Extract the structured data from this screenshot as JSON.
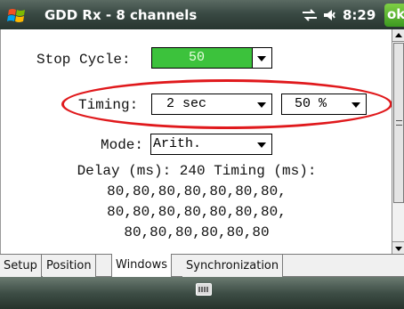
{
  "titlebar": {
    "title": "GDD Rx - 8 channels",
    "time": "8:29",
    "ok_label": "ok"
  },
  "form": {
    "stop_cycle_label": "Stop Cycle:",
    "stop_cycle_value": "50",
    "timing_label": "Timing:",
    "timing_value": "2 sec",
    "timing_percent": "50 %",
    "mode_label": "Mode:",
    "mode_value": "Arith."
  },
  "info": {
    "line1": "Delay (ms): 240 Timing (ms):",
    "line2": "80,80,80,80,80,80,80,",
    "line3": "80,80,80,80,80,80,80,",
    "line4": "80,80,80,80,80,80"
  },
  "tabs": [
    {
      "label": "Setup"
    },
    {
      "label": "Position"
    },
    {
      "label": "Windows"
    },
    {
      "label": "Synchronization"
    }
  ],
  "colors": {
    "highlight_ellipse": "#e0191c",
    "selected_combo": "#3cc23c",
    "ok_button": "#4caf2a"
  },
  "icons": [
    "windows-start-icon",
    "connectivity-icon",
    "volume-icon",
    "keyboard-icon"
  ]
}
